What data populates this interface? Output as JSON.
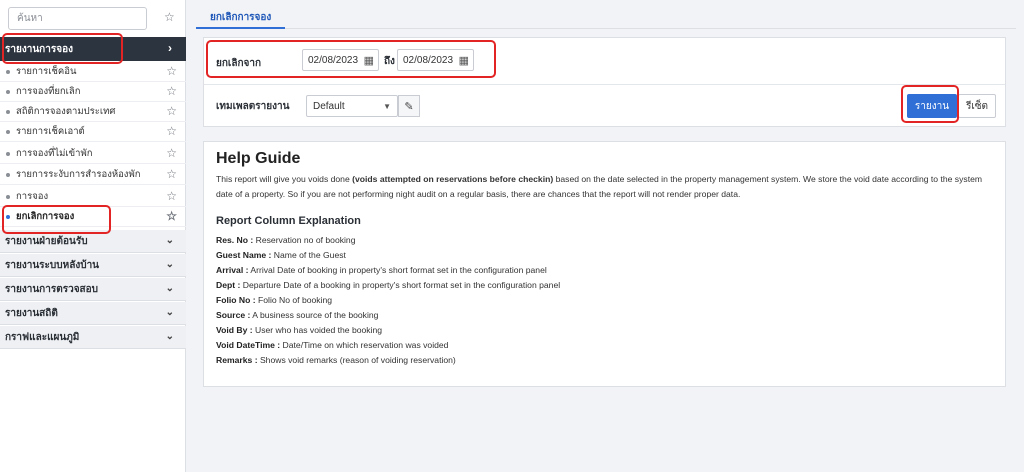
{
  "sidebar": {
    "search_placeholder": "ค้นหา",
    "active_section": "รายงานการจอง",
    "items": [
      {
        "label": "รายการเช็คอิน"
      },
      {
        "label": "การจองที่ยกเลิก"
      },
      {
        "label": "สถิติการจองตามประเทศ"
      },
      {
        "label": "รายการเช็คเอาต์"
      },
      {
        "label": "การจองที่ไม่เข้าพัก"
      },
      {
        "label": "รายการระงับการสำรองห้องพัก"
      },
      {
        "label": "การจอง"
      },
      {
        "label": "ยกเลิกการจอง"
      }
    ],
    "sections": [
      {
        "label": "รายงานฝ่ายต้อนรับ"
      },
      {
        "label": "รายงานระบบหลังบ้าน"
      },
      {
        "label": "รายงานการตรวจสอบ"
      },
      {
        "label": "รายงานสถิติ"
      },
      {
        "label": "กราฟและแผนภูมิ"
      }
    ]
  },
  "tab": {
    "label": "ยกเลิกการจอง"
  },
  "filter": {
    "from_label": "ยกเลิกจาก",
    "from_date": "02/08/2023",
    "to_label": "ถึง",
    "to_date": "02/08/2023",
    "template_label": "เทมเพลตรายงาน",
    "template_value": "Default",
    "report_button": "รายงาน",
    "reset_button": "รีเซ็ต"
  },
  "help": {
    "title": "Help Guide",
    "desc_part1": "This report will give you voids done ",
    "desc_bold": "(voids attempted on reservations before checkin)",
    "desc_part2": " based on the date selected in the property management system. We store the void date according to the system date of a property. So if you are not performing night audit on a regular basis, there are chances that the report will not render proper data.",
    "subtitle": "Report Column Explanation",
    "columns": [
      {
        "name": "Res. No :",
        "desc": " Reservation no of booking"
      },
      {
        "name": "Guest Name :",
        "desc": " Name of the Guest"
      },
      {
        "name": "Arrival :",
        "desc": " Arrival Date of booking in property's short format set in the configuration panel"
      },
      {
        "name": "Dept :",
        "desc": " Departure Date of a booking in property's short format set in the configuration panel"
      },
      {
        "name": "Folio No :",
        "desc": " Folio No of booking"
      },
      {
        "name": "Source :",
        "desc": " A business source of the booking"
      },
      {
        "name": "Void By :",
        "desc": " User who has voided the booking"
      },
      {
        "name": "Void DateTime :",
        "desc": " Date/Time on which reservation was voided"
      },
      {
        "name": "Remarks :",
        "desc": " Shows void remarks (reason of voiding reservation)"
      }
    ]
  }
}
